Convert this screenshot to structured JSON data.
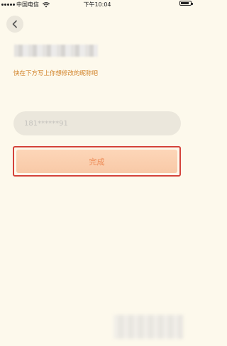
{
  "status_bar": {
    "carrier": "中国电信",
    "time": "下午10:04"
  },
  "header": {
    "back_icon": "chevron-left-icon"
  },
  "form": {
    "hint": "快在下方写上你想修改的昵称吧",
    "nickname_value": "181******91",
    "submit_label": "完成"
  },
  "colors": {
    "background": "#fdf9ec",
    "hint_text": "#d2842b",
    "button_fill": "#f8c9a7",
    "button_text": "#ed8a55",
    "highlight_outline": "#d4433a"
  }
}
